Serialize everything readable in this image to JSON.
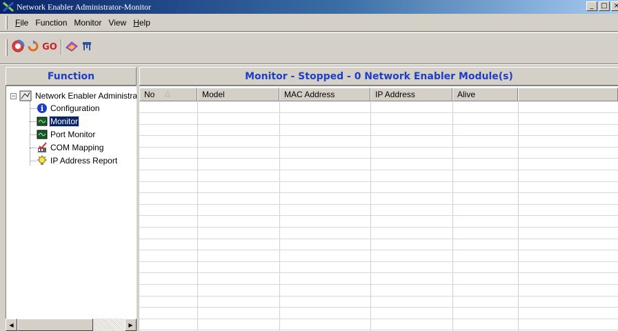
{
  "window": {
    "title": "Network Enabler Administrator-Monitor",
    "buttons": {
      "minimize": "_",
      "maximize": "□",
      "close": "×"
    }
  },
  "menu": {
    "items": [
      {
        "accel": "F",
        "rest": "ile"
      },
      {
        "accel": "",
        "rest": "Function"
      },
      {
        "accel": "",
        "rest": "Monitor"
      },
      {
        "accel": "",
        "rest": "View"
      },
      {
        "accel": "H",
        "rest": "elp"
      }
    ]
  },
  "toolbar": {
    "buttons": [
      "start-monitor-icon",
      "stop-monitor-icon",
      "go-icon",
      "settings-icon",
      "network-icon"
    ],
    "go_label": "GO"
  },
  "left_panel": {
    "header": "Function",
    "root": "Network Enabler Administrator",
    "expander": "−",
    "items": [
      {
        "label": "Configuration",
        "icon": "info-icon",
        "selected": false
      },
      {
        "label": "Monitor",
        "icon": "monitor-icon",
        "selected": true
      },
      {
        "label": "Port Monitor",
        "icon": "port-monitor-icon",
        "selected": false
      },
      {
        "label": "COM Mapping",
        "icon": "com-mapping-icon",
        "selected": false
      },
      {
        "label": "IP Address Report",
        "icon": "ip-report-icon",
        "selected": false
      }
    ],
    "scroll_left": "◀",
    "scroll_right": "▶"
  },
  "right_panel": {
    "header": "Monitor - Stopped - 0 Network Enabler Module(s)",
    "columns": [
      "No",
      "Model",
      "MAC Address",
      "IP Address",
      "Alive"
    ],
    "sort_indicator": "△",
    "rows": []
  },
  "colors": {
    "header_text": "#1c3ec8",
    "title_bar_start": "#0a246a",
    "title_bar_end": "#a6caf0",
    "selection": "#0a246a"
  }
}
